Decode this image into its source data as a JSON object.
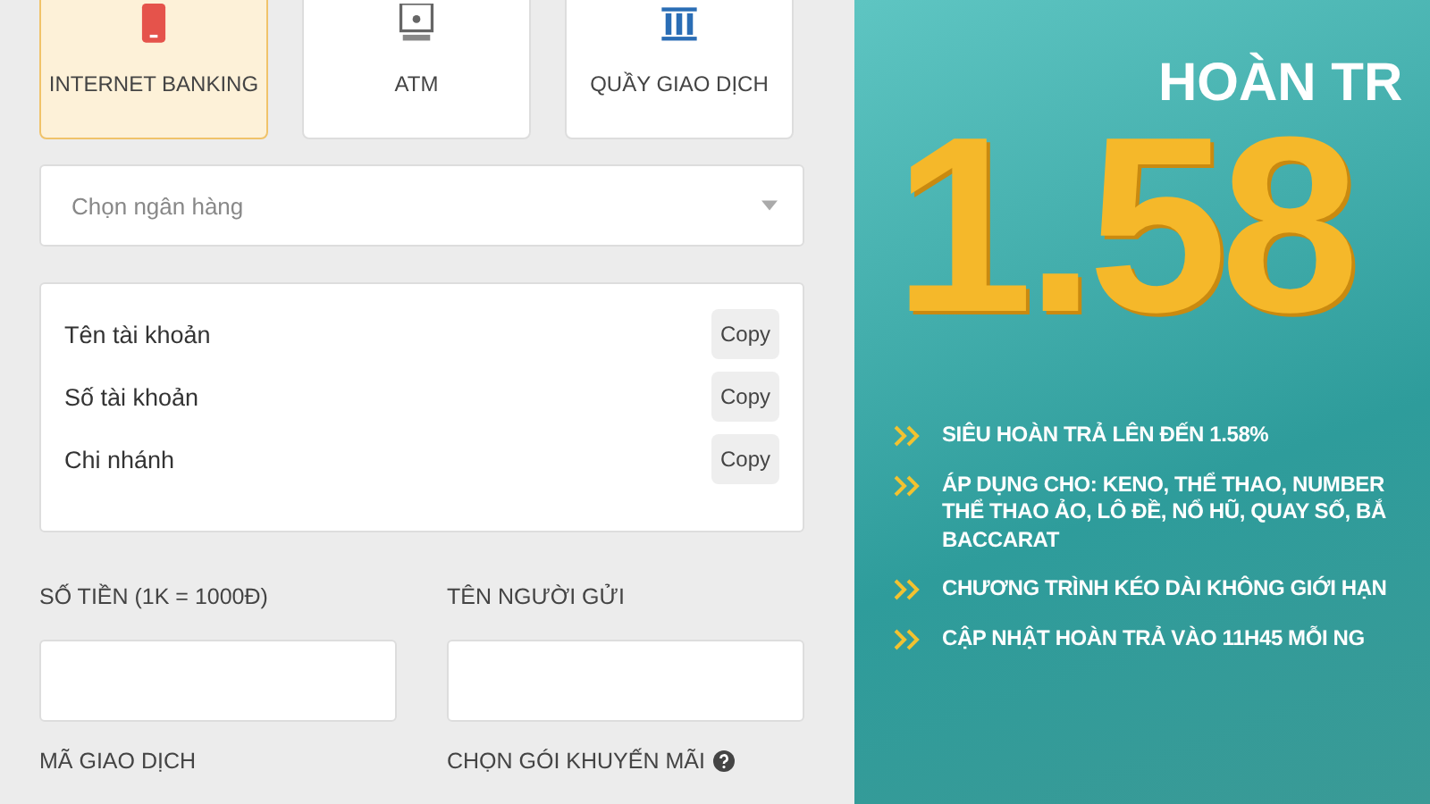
{
  "payment_methods": [
    {
      "label": "INTERNET BANKING",
      "kind": "phone",
      "selected": true
    },
    {
      "label": "ATM",
      "kind": "atm",
      "selected": false
    },
    {
      "label": "QUẦY GIAO DỊCH",
      "kind": "counter",
      "selected": false
    }
  ],
  "bank_select": {
    "placeholder": "Chọn ngân hàng"
  },
  "account_fields": [
    {
      "label": "Tên tài khoản",
      "button": "Copy"
    },
    {
      "label": "Số tài khoản",
      "button": "Copy"
    },
    {
      "label": "Chi nhánh",
      "button": "Copy"
    }
  ],
  "form_fields": [
    {
      "label": "SỐ TIỀN (1K = 1000Đ)",
      "help": false
    },
    {
      "label": "TÊN NGƯỜI GỬI",
      "help": false
    },
    {
      "label": "MÃ GIAO DỊCH",
      "help": false
    },
    {
      "label": "CHỌN GÓI KHUYẾN MÃI",
      "help": true
    }
  ],
  "banner": {
    "title": "HOÀN TR",
    "figure": "1.58",
    "bullets": [
      {
        "lines": [
          "SIÊU HOÀN TRẢ LÊN ĐẾN 1.58%"
        ]
      },
      {
        "lines": [
          "ÁP DỤNG CHO: KENO, THỂ THAO, NUMBER",
          "THỂ THAO ẢO, LÔ ĐỀ, NỔ HŨ, QUAY SỐ, BẮ",
          "BACCARAT"
        ]
      },
      {
        "lines": [
          "CHƯƠNG TRÌNH KÉO DÀI KHÔNG GIỚI HẠN"
        ]
      },
      {
        "lines": [
          "CẬP NHẬT HOÀN TRẢ VÀO 11H45 MỖI NG"
        ]
      }
    ]
  }
}
